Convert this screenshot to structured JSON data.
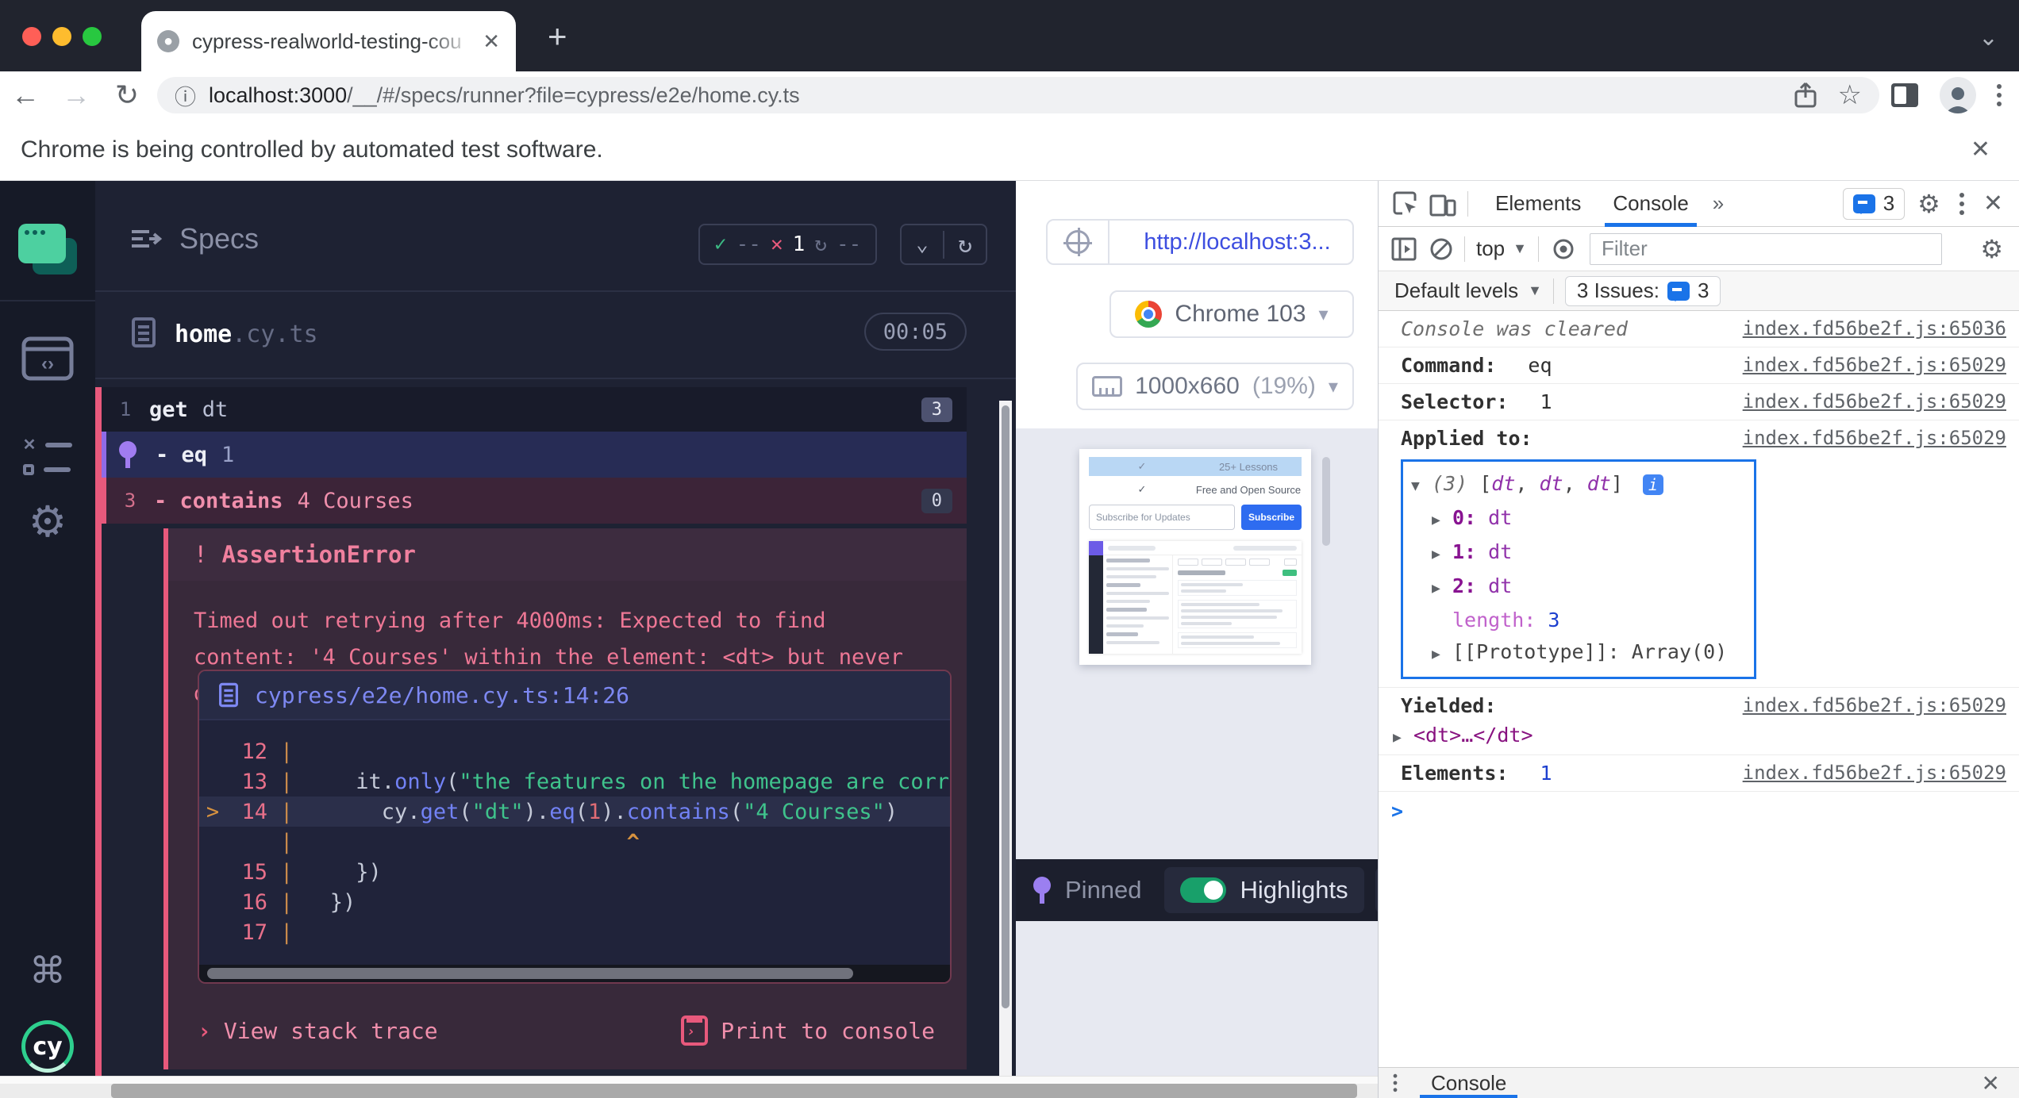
{
  "browser": {
    "tab_title": "cypress-realworld-testing-cou",
    "url_host": "localhost:3000",
    "url_path": "/__/#/specs/runner?file=cypress/e2e/home.cy.ts",
    "banner_text": "Chrome is being controlled by automated test software."
  },
  "specs_panel": {
    "title": "Specs",
    "stats": {
      "passed": "--",
      "failed": "1",
      "skipped": "--"
    },
    "spec_name": "home",
    "spec_ext": ".cy.ts",
    "duration": "00:05",
    "commands": [
      {
        "num": "1",
        "method": "get",
        "message": "dt",
        "badge": "3"
      },
      {
        "num": "",
        "method": "- eq",
        "message": "1",
        "badge": ""
      },
      {
        "num": "3",
        "method": "- contains",
        "message": "4 Courses",
        "badge": "0"
      }
    ],
    "error": {
      "prefix": "!",
      "name": "AssertionError",
      "message": "Timed out retrying after 4000ms: Expected to find content: '4 Courses' within the element: <dt> but never did.",
      "code_frame": {
        "file": "cypress/e2e/home.cy.ts:14:26",
        "lines": [
          {
            "num": "12",
            "mark": "",
            "tokens": []
          },
          {
            "num": "13",
            "mark": "",
            "tokens": [
              [
                "    it",
                "p"
              ],
              [
                ".",
                "p"
              ],
              [
                "only",
                "fn"
              ],
              [
                "(",
                "p"
              ],
              [
                "\"the features on the homepage are correct\"",
                "str"
              ]
            ]
          },
          {
            "num": "14",
            "mark": ">",
            "tokens": [
              [
                "      cy",
                "p"
              ],
              [
                ".",
                "p"
              ],
              [
                "get",
                "fn"
              ],
              [
                "(",
                "p"
              ],
              [
                "\"dt\"",
                "str"
              ],
              [
                ")",
                "p"
              ],
              [
                ".",
                "p"
              ],
              [
                "eq",
                "fn"
              ],
              [
                "(",
                "p"
              ],
              [
                "1",
                "num"
              ],
              [
                ")",
                "p"
              ],
              [
                ".",
                "p"
              ],
              [
                "contains",
                "fn"
              ],
              [
                "(",
                "p"
              ],
              [
                "\"4 Courses\"",
                "str"
              ],
              [
                ")",
                "p"
              ]
            ]
          },
          {
            "num": "",
            "mark": "",
            "tokens": [
              [
                "                         ^",
                "caret"
              ]
            ]
          },
          {
            "num": "15",
            "mark": "",
            "tokens": [
              [
                "    })",
                "p"
              ]
            ]
          },
          {
            "num": "16",
            "mark": "",
            "tokens": [
              [
                "  })",
                "p"
              ]
            ]
          },
          {
            "num": "17",
            "mark": "",
            "tokens": []
          }
        ]
      },
      "stack_link": "View stack trace",
      "print_link": "Print to console"
    }
  },
  "aut_panel": {
    "url": "http://localhost:3...",
    "browser_name": "Chrome 103",
    "viewport": "1000x660",
    "zoom": "(19%)",
    "pinned_label": "Pinned",
    "highlights_label": "Highlights",
    "preview": {
      "lessons_row": "25+ Lessons",
      "open_source_row": "Free and Open Source",
      "subscribe_placeholder": "Subscribe for Updates",
      "subscribe_button": "Subscribe"
    }
  },
  "devtools": {
    "tab_elements": "Elements",
    "tab_console": "Console",
    "more_tabs": "»",
    "issues_badge": "3",
    "context": "top",
    "filter_placeholder": "Filter",
    "levels": "Default levels",
    "issues_text": "3 Issues:",
    "issues_count": "3",
    "console": {
      "cleared": {
        "text": "Console was cleared",
        "link": "index.fd56be2f.js:65036"
      },
      "command": {
        "key": "Command:",
        "value": "eq",
        "link": "index.fd56be2f.js:65029"
      },
      "selector": {
        "key": "Selector:",
        "value": "1",
        "link": "index.fd56be2f.js:65029"
      },
      "applied": {
        "key": "Applied to:",
        "link": "index.fd56be2f.js:65029",
        "count": "(3)",
        "open": " [",
        "close": "] ",
        "comma": ", ",
        "items": [
          "dt",
          "dt",
          "dt"
        ],
        "info_badge": "i",
        "entries": [
          {
            "key": "0:",
            "value": "dt"
          },
          {
            "key": "1:",
            "value": "dt"
          },
          {
            "key": "2:",
            "value": "dt"
          }
        ],
        "length_key": "length:",
        "length_value": "3",
        "proto_key": "[[Prototype]]:",
        "proto_value": "Array(0)"
      },
      "yielded": {
        "key": "Yielded:",
        "value": "<dt>…</dt>",
        "link": "index.fd56be2f.js:65029"
      },
      "elements": {
        "key": "Elements:",
        "value": "1",
        "link": "index.fd56be2f.js:65029"
      },
      "prompt": ">"
    },
    "drawer_tab": "Console"
  }
}
